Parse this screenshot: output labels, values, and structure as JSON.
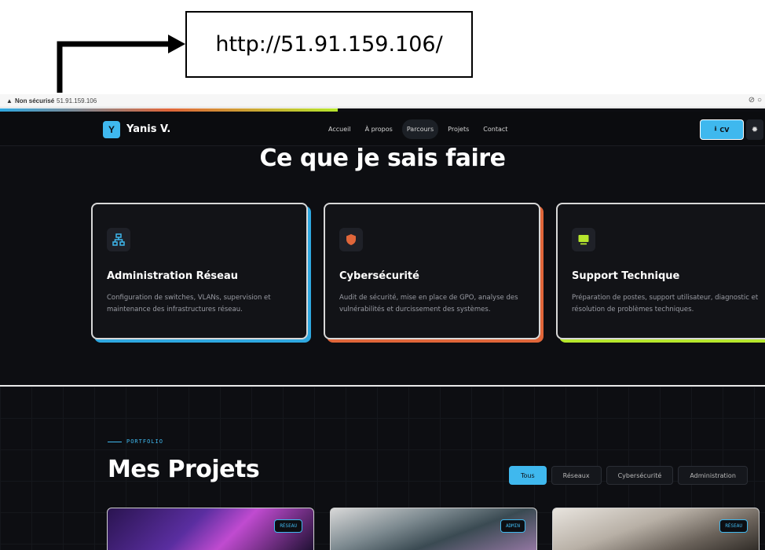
{
  "annotation": {
    "url_text": "http://51.91.159.106/"
  },
  "browser": {
    "security_label": "Non sécurisé",
    "url": "51.91.159.106"
  },
  "header": {
    "logo_letter": "Y",
    "brand": "Yanis V.",
    "nav": [
      "Accueil",
      "À propos",
      "Parcours",
      "Projets",
      "Contact"
    ],
    "active_nav": "Parcours",
    "cv_label": "CV"
  },
  "skills": {
    "title": "Ce que je sais faire",
    "cards": [
      {
        "icon": "network-icon",
        "title": "Administration Réseau",
        "description": "Configuration de switches, VLANs, supervision et maintenance des infrastructures réseau.",
        "accent": "#2fa8e0"
      },
      {
        "icon": "shield-icon",
        "title": "Cybersécurité",
        "description": "Audit de sécurité, mise en place de GPO, analyse des vulnérabilités et durcissement des systèmes.",
        "accent": "#e0663a"
      },
      {
        "icon": "monitor-icon",
        "title": "Support Technique",
        "description": "Préparation de postes, support utilisateur, diagnostic et résolution de problèmes techniques.",
        "accent": "#b6e62d"
      }
    ]
  },
  "portfolio": {
    "label": "PORTFOLIO",
    "title": "Mes Projets",
    "filters": [
      "Tous",
      "Réseaux",
      "Cybersécurité",
      "Administration"
    ],
    "active_filter": "Tous",
    "projects": [
      {
        "tag": "RÉSEAU"
      },
      {
        "tag": "ADMIN"
      },
      {
        "tag": "RÉSEAU"
      }
    ]
  },
  "colors": {
    "accent": "#3fb8ee",
    "background": "#0d0e12"
  }
}
